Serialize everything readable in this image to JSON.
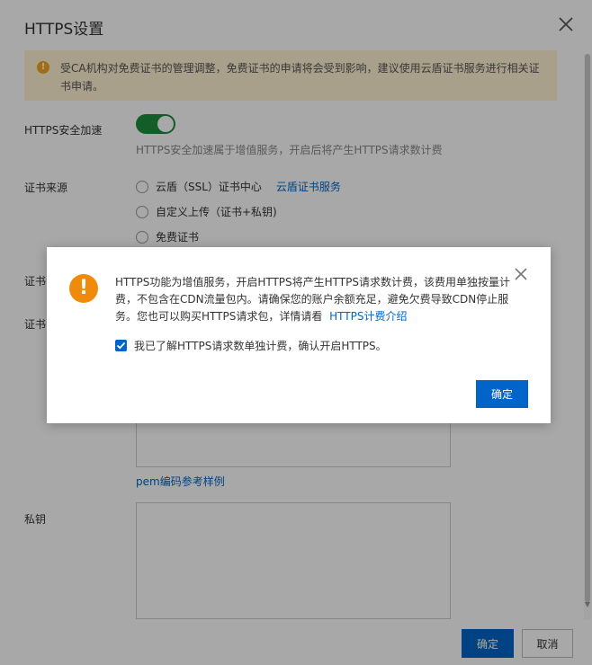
{
  "drawer": {
    "title": "HTTPS设置",
    "notice": "受CA机构对免费证书的管理调整，免费证书的申请将会受到影响，建议使用云盾证书服务进行相关证书申请。",
    "https_accel_label": "HTTPS安全加速",
    "https_accel_enabled": true,
    "https_accel_help": "HTTPS安全加速属于增值服务，开启后将产生HTTPS请求数计费",
    "cert_source_label": "证书来源",
    "cert_source_options": [
      "云盾（SSL）证书中心",
      "自定义上传（证书+私钥)",
      "免费证书"
    ],
    "cert_source_link": "云盾证书服务",
    "cert_name_label": "证书",
    "cert_content_label": "证书",
    "pem_link": "pem编码参考样例",
    "private_key_label": "私钥",
    "ok_label": "确定",
    "cancel_label": "取消"
  },
  "modal": {
    "text": "HTTPS功能为增值服务，开启HTTPS将产生HTTPS请求数计费，该费用单独按量计费，不包含在CDN流量包内。请确保您的账户余额充足，避免欠费导致CDN停止服务。您也可以购买HTTPS请求包，详情请看",
    "link": "HTTPS计费介绍",
    "checkbox_label": "我已了解HTTPS请求数单独计费，确认开启HTTPS。",
    "checkbox_checked": true,
    "ok_label": "确定"
  },
  "colors": {
    "primary": "#0064c8",
    "switch_on": "#1e8e3e",
    "warning": "#f08a0a",
    "notice_bg": "#fff3d4"
  },
  "icons": {
    "close": "close-icon",
    "warning": "warning-icon",
    "exclamation": "exclamation-icon"
  }
}
